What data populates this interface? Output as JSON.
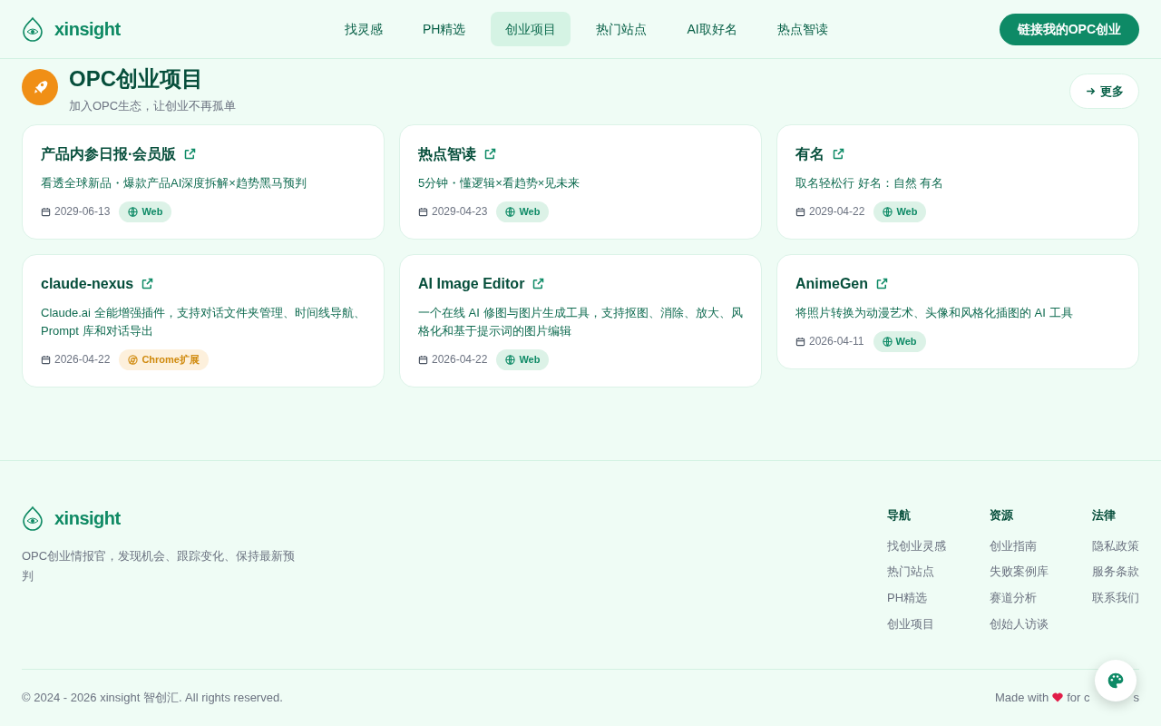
{
  "header": {
    "logo": "xinsight",
    "nav": [
      {
        "label": "找灵感",
        "selected": false
      },
      {
        "label": "PH精选",
        "selected": false
      },
      {
        "label": "创业项目",
        "selected": true
      },
      {
        "label": "热门站点",
        "selected": false
      },
      {
        "label": "AI取好名",
        "selected": false
      },
      {
        "label": "热点智读",
        "selected": false
      }
    ],
    "cta": "链接我的OPC创业"
  },
  "section": {
    "title": "OPC创业项目",
    "subtitle": "加入OPC生态，让创业不再孤单",
    "more": "更多"
  },
  "projects": [
    {
      "title": "产品内参日报·会员版",
      "description": "看透全球新品・爆款产品AI深度拆解×趋势黑马预判",
      "date": "2029-06-13",
      "tag": "Web",
      "kind": "web"
    },
    {
      "title": "热点智读",
      "description": "5分钟・懂逻辑×看趋势×见未来",
      "date": "2029-04-23",
      "tag": "Web",
      "kind": "web"
    },
    {
      "title": "有名",
      "description": "取名轻松行 好名：自然 有名",
      "date": "2029-04-22",
      "tag": "Web",
      "kind": "web"
    },
    {
      "title": "claude-nexus",
      "description": "Claude.ai 全能增强插件，支持对话文件夹管理、时间线导航、Prompt 库和对话导出",
      "date": "2026-04-22",
      "tag": "Chrome扩展",
      "kind": "chrome"
    },
    {
      "title": "AI Image Editor",
      "description": "一个在线 AI 修图与图片生成工具，支持抠图、消除、放大、风格化和基于提示词的图片编辑",
      "date": "2026-04-22",
      "tag": "Web",
      "kind": "web"
    },
    {
      "title": "AnimeGen",
      "description": "将照片转换为动漫艺术、头像和风格化插图的 AI 工具",
      "date": "2026-04-11",
      "tag": "Web",
      "kind": "web"
    }
  ],
  "footer": {
    "logo": "xinsight",
    "tagline": "OPC创业情报官，发现机会、跟踪变化、保持最新预判",
    "columns": [
      {
        "heading": "导航",
        "links": [
          "找创业灵感",
          "热门站点",
          "PH精选",
          "创业项目"
        ]
      },
      {
        "heading": "资源",
        "links": [
          "创业指南",
          "失败案例库",
          "赛道分析",
          "创始人访谈"
        ]
      },
      {
        "heading": "法律",
        "links": [
          "隐私政策",
          "服务条款",
          "联系我们"
        ]
      }
    ],
    "copyright": "© 2024 - 2026 xinsight 智创汇. All rights reserved.",
    "made_with": "Made with",
    "made_for": "for c",
    "made_tail": "s"
  }
}
